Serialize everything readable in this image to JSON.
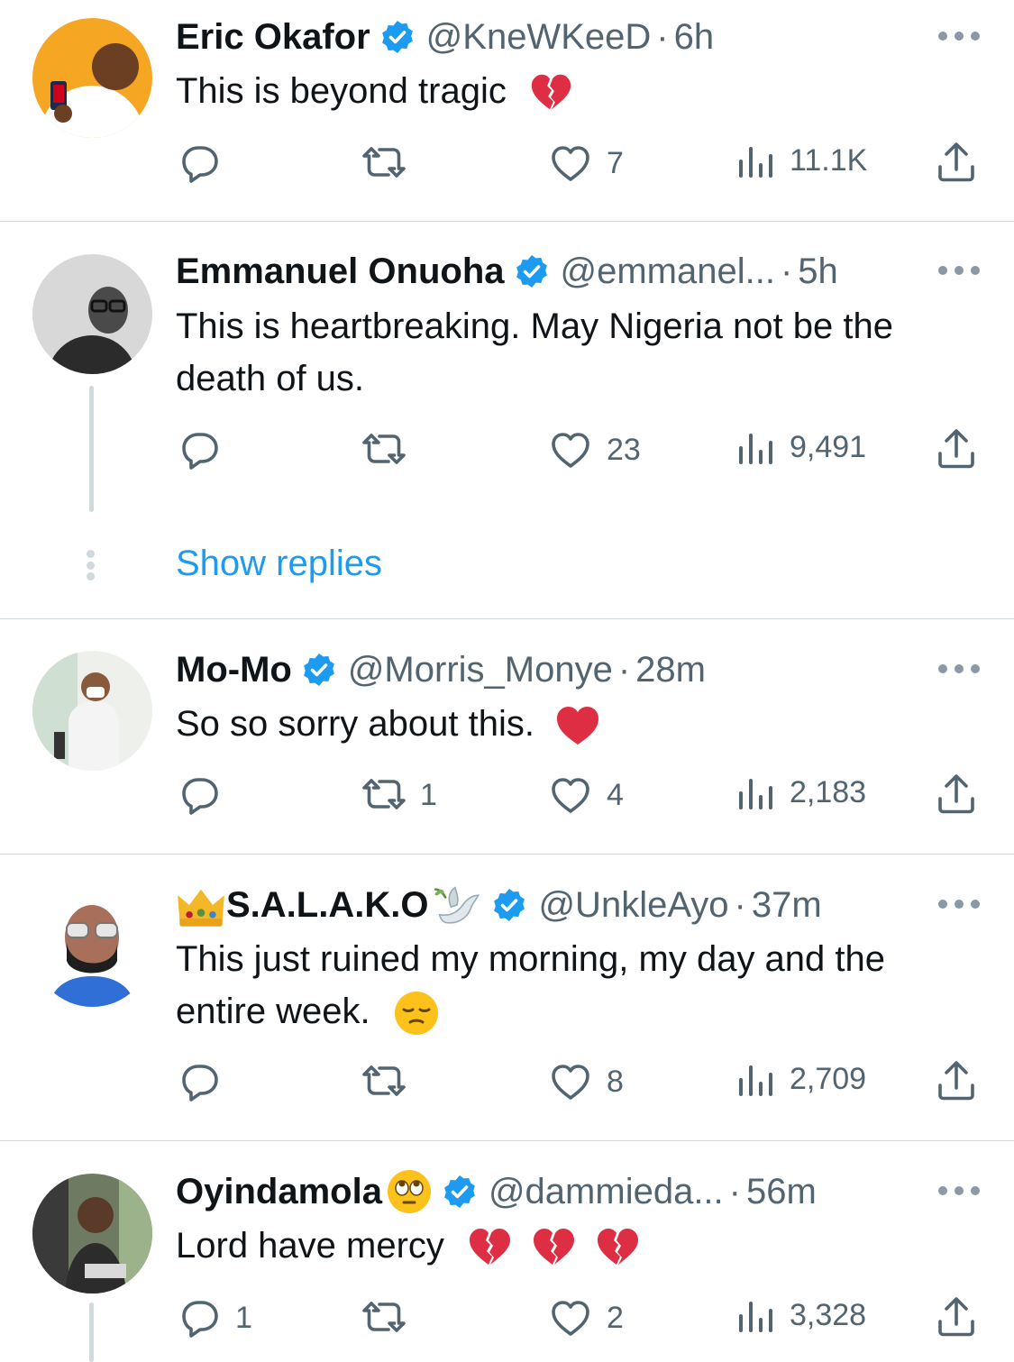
{
  "tweets": [
    {
      "name": "Eric Okafor",
      "handle": "@KneWKeeD",
      "time": "6h",
      "text": "This is beyond tragic",
      "emojis": [
        "broken-heart"
      ],
      "stats": {
        "replies": "",
        "retweets": "",
        "likes": "7",
        "views": "11.1K"
      }
    },
    {
      "name": "Emmanuel Onuoha",
      "handle": "@emmanel...",
      "time": "5h",
      "text": "This is heartbreaking. May Nigeria not be the death of us.",
      "emojis": [],
      "stats": {
        "replies": "",
        "retweets": "",
        "likes": "23",
        "views": "9,491"
      }
    },
    {
      "name": "Mo-Mo",
      "handle": "@Morris_Monye",
      "time": "28m",
      "text": "So so sorry about this.",
      "emojis": [
        "red-heart"
      ],
      "stats": {
        "replies": "",
        "retweets": "1",
        "likes": "4",
        "views": "2,183"
      }
    },
    {
      "name": "S.A.L.A.K.O",
      "name_emojis": [
        "crown",
        "dove"
      ],
      "handle": "@UnkleAyo",
      "time": "37m",
      "text": "This just ruined my morning, my day and the entire week.",
      "emojis": [
        "pensive-face"
      ],
      "stats": {
        "replies": "",
        "retweets": "",
        "likes": "8",
        "views": "2,709"
      }
    },
    {
      "name": "Oyindamola",
      "name_emojis": [
        "eye-roll-face"
      ],
      "handle": "@dammieda...",
      "time": "56m",
      "text": "Lord have mercy",
      "emojis": [
        "broken-heart",
        "broken-heart",
        "broken-heart"
      ],
      "stats": {
        "replies": "1",
        "retweets": "",
        "likes": "2",
        "views": "3,328"
      }
    }
  ],
  "show_replies_label": "Show replies",
  "separator": "·",
  "colors": {
    "accent": "#1d9bf0",
    "text": "#0f1419",
    "muted": "#536471",
    "divider": "#cfd9de"
  },
  "icons": [
    "reply-icon",
    "retweet-icon",
    "like-icon",
    "views-icon",
    "share-icon",
    "verified-badge-icon",
    "more-icon"
  ]
}
